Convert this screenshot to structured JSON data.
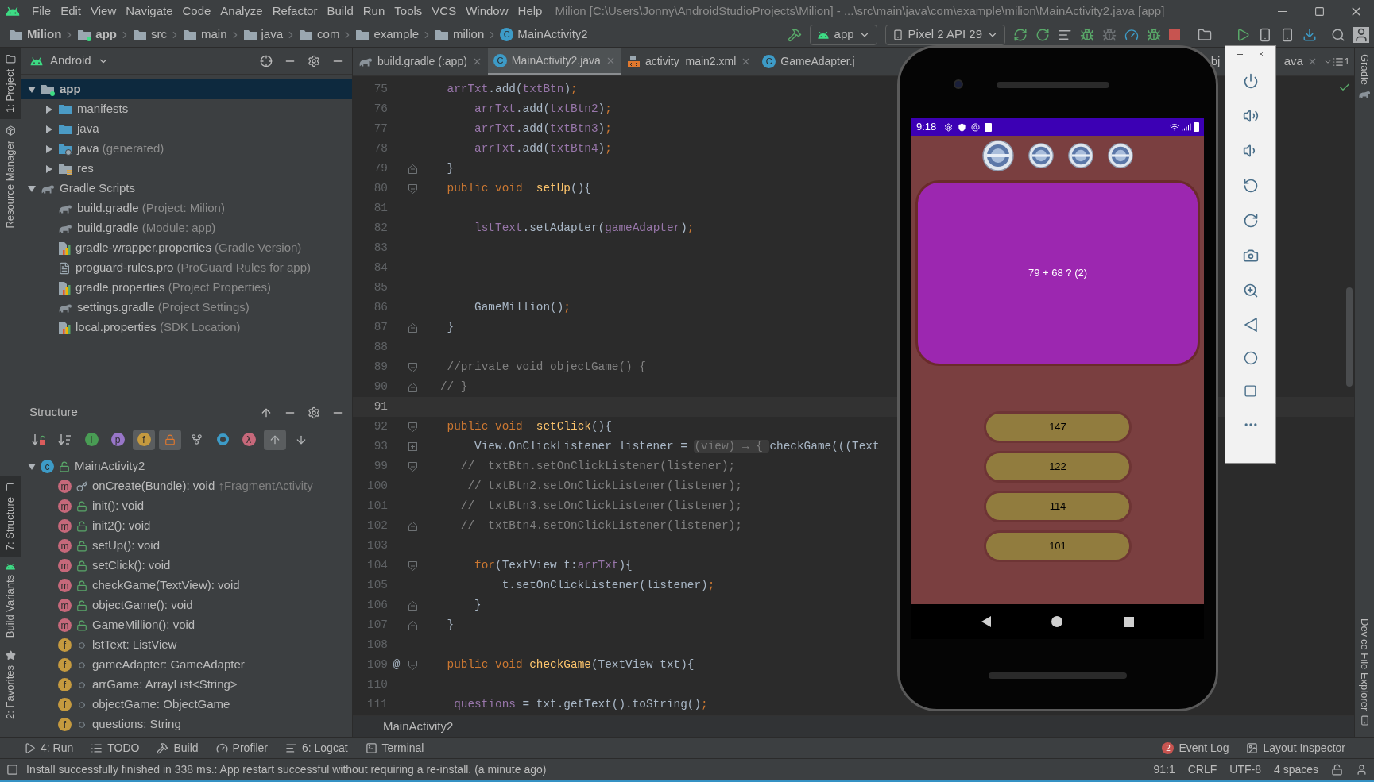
{
  "menu": [
    "File",
    "Edit",
    "View",
    "Navigate",
    "Code",
    "Analyze",
    "Refactor",
    "Build",
    "Run",
    "Tools",
    "VCS",
    "Window",
    "Help"
  ],
  "window_title": "Milion [C:\\Users\\Jonny\\AndroidStudioProjects\\Milion] - ...\\src\\main\\java\\com\\example\\milion\\MainActivity2.java [app]",
  "breadcrumbs": [
    {
      "label": "Milion",
      "kind": "project"
    },
    {
      "label": "app",
      "kind": "module"
    },
    {
      "label": "src",
      "kind": "folder"
    },
    {
      "label": "main",
      "kind": "folder"
    },
    {
      "label": "java",
      "kind": "folder"
    },
    {
      "label": "com",
      "kind": "package"
    },
    {
      "label": "example",
      "kind": "package"
    },
    {
      "label": "milion",
      "kind": "package"
    },
    {
      "label": "MainActivity2",
      "kind": "class",
      "badge": "C"
    }
  ],
  "run_config": "app",
  "device": "Pixel 2 API 29",
  "left_tool_tabs": [
    {
      "label": "1: Project",
      "kind": "project",
      "selected": true
    },
    {
      "label": "Resource Manager",
      "kind": "resources",
      "selected": false
    }
  ],
  "left_tool_tabs_bottom": [
    {
      "label": "7: Structure",
      "kind": "structure",
      "selected": true
    },
    {
      "label": "Build Variants",
      "kind": "android",
      "selected": false
    },
    {
      "label": "2: Favorites",
      "kind": "favorites",
      "selected": false
    }
  ],
  "project_panel": {
    "view": "Android",
    "tree": [
      {
        "label": "app",
        "kind": "module",
        "selected": true,
        "expanded": true,
        "children": [
          {
            "label": "manifests",
            "kind": "folder",
            "selected": false,
            "expanded": false
          },
          {
            "label": "java",
            "kind": "folder",
            "selected": false,
            "expanded": false
          },
          {
            "label": "java",
            "hint": "(generated)",
            "kind": "generated-folder",
            "selected": false,
            "expanded": false
          },
          {
            "label": "res",
            "kind": "res-folder",
            "selected": false,
            "expanded": false
          }
        ]
      },
      {
        "label": "Gradle Scripts",
        "kind": "gradle",
        "selected": false,
        "expanded": true,
        "children": [
          {
            "label": "build.gradle",
            "hint": "(Project: Milion)",
            "kind": "gradle",
            "selected": false
          },
          {
            "label": "build.gradle",
            "hint": "(Module: app)",
            "kind": "gradle",
            "selected": false
          },
          {
            "label": "gradle-wrapper.properties",
            "hint": "(Gradle Version)",
            "kind": "properties",
            "selected": false
          },
          {
            "label": "proguard-rules.pro",
            "hint": "(ProGuard Rules for app)",
            "kind": "text-file",
            "selected": false
          },
          {
            "label": "gradle.properties",
            "hint": "(Project Properties)",
            "kind": "properties",
            "selected": false
          },
          {
            "label": "settings.gradle",
            "hint": "(Project Settings)",
            "kind": "gradle",
            "selected": false
          },
          {
            "label": "local.properties",
            "hint": "(SDK Location)",
            "kind": "properties",
            "selected": false
          }
        ]
      }
    ]
  },
  "structure_panel": {
    "title": "Structure",
    "toolbar": [
      {
        "kind": "sort-visibility",
        "on": false
      },
      {
        "kind": "sort-alpha",
        "on": false
      },
      {
        "kind": "inherited",
        "glyph": "I",
        "on": false
      },
      {
        "kind": "properties",
        "glyph": "p",
        "on": false
      },
      {
        "kind": "fields",
        "glyph": "f",
        "on": true
      },
      {
        "kind": "non-public",
        "on": true
      },
      {
        "kind": "hierarchy",
        "on": false
      },
      {
        "kind": "anonymous",
        "on": false
      },
      {
        "kind": "lambdas",
        "glyph": "λ",
        "on": false
      },
      {
        "kind": "autoscroll-to",
        "on": true
      },
      {
        "kind": "autoscroll-from",
        "on": false
      }
    ],
    "tree": [
      {
        "label": "MainActivity2",
        "kind": "public-class",
        "badge": "c",
        "selected": false,
        "expanded": true,
        "children": [
          {
            "label": "onCreate(Bundle): void",
            "hint": "↑FragmentActivity",
            "kind": "protected-method",
            "badge": "m",
            "selected": false
          },
          {
            "label": "init(): void",
            "kind": "public-method",
            "badge": "m",
            "selected": false
          },
          {
            "label": "init2(): void",
            "kind": "public-method",
            "badge": "m",
            "selected": false
          },
          {
            "label": "setUp(): void",
            "kind": "public-method",
            "badge": "m",
            "selected": false
          },
          {
            "label": "setClick(): void",
            "kind": "public-method",
            "badge": "m",
            "selected": false
          },
          {
            "label": "checkGame(TextView): void",
            "kind": "public-method",
            "badge": "m",
            "selected": false
          },
          {
            "label": "objectGame(): void",
            "kind": "public-method",
            "badge": "m",
            "selected": false
          },
          {
            "label": "GameMillion(): void",
            "kind": "public-method",
            "badge": "m",
            "selected": false
          },
          {
            "label": "lstText: ListView",
            "kind": "package-field",
            "badge": "f",
            "selected": false
          },
          {
            "label": "gameAdapter: GameAdapter",
            "kind": "package-field",
            "badge": "f",
            "selected": false
          },
          {
            "label": "arrGame: ArrayList<String>",
            "kind": "package-field",
            "badge": "f",
            "selected": false
          },
          {
            "label": "objectGame: ObjectGame",
            "kind": "package-field",
            "badge": "f",
            "selected": false
          },
          {
            "label": "questions: String",
            "kind": "package-field",
            "badge": "f",
            "selected": false
          }
        ]
      }
    ]
  },
  "editor": {
    "tabs": [
      {
        "label": "build.gradle (:app)",
        "kind": "gradle",
        "selected": false
      },
      {
        "label": "MainActivity2.java",
        "kind": "class",
        "badge": "C",
        "selected": true
      },
      {
        "label": "activity_main2.xml",
        "kind": "layout",
        "selected": false
      },
      {
        "label": "GameAdapter.j",
        "kind": "class",
        "badge": "C",
        "selected": false
      }
    ],
    "partial_tab": {
      "start": "bj",
      "end": "ava"
    },
    "tab_count": "1",
    "lines": [
      {
        "number": "75",
        "tokens": [
          {
            "kind": "field",
            "text": "    arrTxt"
          },
          {
            "kind": "plain",
            "text": ".add("
          },
          {
            "kind": "field",
            "text": "txtBtn"
          },
          {
            "kind": "plain",
            "text": ")"
          },
          {
            "kind": "kw",
            "text": ";"
          }
        ]
      },
      {
        "number": "76",
        "tokens": [
          {
            "kind": "field",
            "text": "        arrTxt"
          },
          {
            "kind": "plain",
            "text": ".add("
          },
          {
            "kind": "field",
            "text": "txtBtn2"
          },
          {
            "kind": "plain",
            "text": ")"
          },
          {
            "kind": "kw",
            "text": ";"
          }
        ]
      },
      {
        "number": "77",
        "tokens": [
          {
            "kind": "field",
            "text": "        arrTxt"
          },
          {
            "kind": "plain",
            "text": ".add("
          },
          {
            "kind": "field",
            "text": "txtBtn3"
          },
          {
            "kind": "plain",
            "text": ")"
          },
          {
            "kind": "kw",
            "text": ";"
          }
        ]
      },
      {
        "number": "78",
        "tokens": [
          {
            "kind": "field",
            "text": "        arrTxt"
          },
          {
            "kind": "plain",
            "text": ".add("
          },
          {
            "kind": "field",
            "text": "txtBtn4"
          },
          {
            "kind": "plain",
            "text": ")"
          },
          {
            "kind": "kw",
            "text": ";"
          }
        ]
      },
      {
        "number": "79",
        "fold_end": true,
        "tokens": [
          {
            "kind": "plain",
            "text": "    }"
          }
        ]
      },
      {
        "number": "80",
        "fold_start": true,
        "tokens": [
          {
            "kind": "kw",
            "text": "    public void  "
          },
          {
            "kind": "decl",
            "text": "setUp"
          },
          {
            "kind": "plain",
            "text": "(){"
          }
        ]
      },
      {
        "number": "81"
      },
      {
        "number": "82",
        "tokens": [
          {
            "kind": "field",
            "text": "        lstText"
          },
          {
            "kind": "plain",
            "text": ".setAdapter("
          },
          {
            "kind": "field",
            "text": "gameAdapter"
          },
          {
            "kind": "plain",
            "text": ")"
          },
          {
            "kind": "kw",
            "text": ";"
          }
        ]
      },
      {
        "number": "83"
      },
      {
        "number": "84"
      },
      {
        "number": "85"
      },
      {
        "number": "86",
        "tokens": [
          {
            "kind": "plain",
            "text": "        GameMillion()"
          },
          {
            "kind": "kw",
            "text": ";"
          }
        ]
      },
      {
        "number": "87",
        "fold_end": true,
        "tokens": [
          {
            "kind": "plain",
            "text": "    }"
          }
        ]
      },
      {
        "number": "88"
      },
      {
        "number": "89",
        "fold_start": true,
        "tokens": [
          {
            "kind": "comment",
            "text": "    //private void objectGame() {"
          }
        ]
      },
      {
        "number": "90",
        "fold_end": true,
        "tokens": [
          {
            "kind": "comment",
            "text": "   // }"
          }
        ]
      },
      {
        "number": "91",
        "current": true
      },
      {
        "number": "92",
        "fold_start": true,
        "tokens": [
          {
            "kind": "kw",
            "text": "    public void  "
          },
          {
            "kind": "decl",
            "text": "setClick"
          },
          {
            "kind": "plain",
            "text": "(){"
          }
        ]
      },
      {
        "number": "93",
        "collapsed": true,
        "tokens": [
          {
            "kind": "plain",
            "text": "        View.OnClickListener listener = "
          },
          {
            "kind": "hint",
            "text": "(view) → { "
          },
          {
            "kind": "plain",
            "text": "checkGame(((Text"
          }
        ]
      },
      {
        "number": "99",
        "fold_start": true,
        "tokens": [
          {
            "kind": "comment",
            "text": "      //  txtBtn.setOnClickListener(listener);"
          }
        ]
      },
      {
        "number": "100",
        "tokens": [
          {
            "kind": "comment",
            "text": "       // txtBtn2.setOnClickListener(listener);"
          }
        ]
      },
      {
        "number": "101",
        "tokens": [
          {
            "kind": "comment",
            "text": "      //  txtBtn3.setOnClickListener(listener);"
          }
        ]
      },
      {
        "number": "102",
        "fold_end": true,
        "tokens": [
          {
            "kind": "comment",
            "text": "      //  txtBtn4.setOnClickListener(listener);"
          }
        ]
      },
      {
        "number": "103"
      },
      {
        "number": "104",
        "fold_start": true,
        "tokens": [
          {
            "kind": "kw",
            "text": "        for"
          },
          {
            "kind": "plain",
            "text": "(TextView t:"
          },
          {
            "kind": "field",
            "text": "arrTxt"
          },
          {
            "kind": "plain",
            "text": "){"
          }
        ]
      },
      {
        "number": "105",
        "tokens": [
          {
            "kind": "plain",
            "text": "            t.setOnClickListener(listener)"
          },
          {
            "kind": "kw",
            "text": ";"
          }
        ]
      },
      {
        "number": "106",
        "fold_end": true,
        "tokens": [
          {
            "kind": "plain",
            "text": "        }"
          }
        ]
      },
      {
        "number": "107",
        "fold_end": true,
        "tokens": [
          {
            "kind": "plain",
            "text": "    }"
          }
        ]
      },
      {
        "number": "108"
      },
      {
        "number": "109",
        "marker": "@",
        "fold_start": true,
        "tokens": [
          {
            "kind": "kw",
            "text": "    public void "
          },
          {
            "kind": "decl",
            "text": "checkGame"
          },
          {
            "kind": "plain",
            "text": "(TextView txt){"
          }
        ]
      },
      {
        "number": "110"
      },
      {
        "number": "111",
        "tokens": [
          {
            "kind": "field",
            "text": "     questions"
          },
          {
            "kind": "plain",
            "text": " = txt.getText().toString()"
          },
          {
            "kind": "kw",
            "text": ";"
          }
        ]
      }
    ],
    "breadcrumb": "MainActivity2"
  },
  "emulator": {
    "status_time": "9:18",
    "question": "79 + 68 ? (2)",
    "answers": [
      "147",
      "122",
      "114",
      "101"
    ]
  },
  "right_tool_tabs": [
    {
      "label": "Gradle",
      "kind": "gradle"
    },
    {
      "label": "Device File Explorer",
      "kind": "device"
    }
  ],
  "bottom_tabs": [
    {
      "label": "4: Run",
      "kind": "run"
    },
    {
      "label": "TODO",
      "kind": "todo"
    },
    {
      "label": "Build",
      "kind": "build"
    },
    {
      "label": "Profiler",
      "kind": "profiler"
    },
    {
      "label": "6: Logcat",
      "kind": "logcat"
    },
    {
      "label": "Terminal",
      "kind": "terminal"
    }
  ],
  "bottom_right": [
    {
      "label": "Event Log",
      "badge": "2",
      "kind": "event-log"
    },
    {
      "label": "Layout Inspector",
      "kind": "layout-inspector"
    }
  ],
  "status_bar": {
    "message": "Install successfully finished in 338 ms.: App restart successful without requiring a re-install. (a minute ago)",
    "items": [
      "91:1",
      "CRLF",
      "UTF-8",
      "4 spaces"
    ]
  }
}
